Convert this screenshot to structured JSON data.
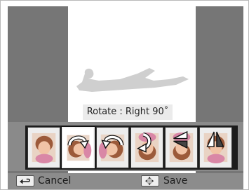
{
  "caption": "Rotate : Right 90˚",
  "footer": {
    "cancel_label": "Cancel",
    "save_label": "Save",
    "cancel_icon": "back-arrow-icon",
    "save_icon": "dpad-icon"
  },
  "thumbnails": [
    {
      "name": "original",
      "icon": "none",
      "selected": false
    },
    {
      "name": "rotate-right-90",
      "icon": "rotate-right-arrow-icon",
      "selected": true
    },
    {
      "name": "rotate-left-90",
      "icon": "rotate-left-arrow-icon",
      "selected": false
    },
    {
      "name": "rotate-180",
      "icon": "rotate-180-arrow-icon",
      "selected": false
    },
    {
      "name": "flip-vertical",
      "icon": "flip-vertical-icon",
      "selected": false
    },
    {
      "name": "flip-horizontal",
      "icon": "flip-horizontal-icon",
      "selected": false
    }
  ],
  "colors": {
    "side_panels": "#767676",
    "bottom_bar": "#8c8c8c",
    "filmstrip": "#1c1c1c",
    "caption_bg": "#ebebeb"
  }
}
